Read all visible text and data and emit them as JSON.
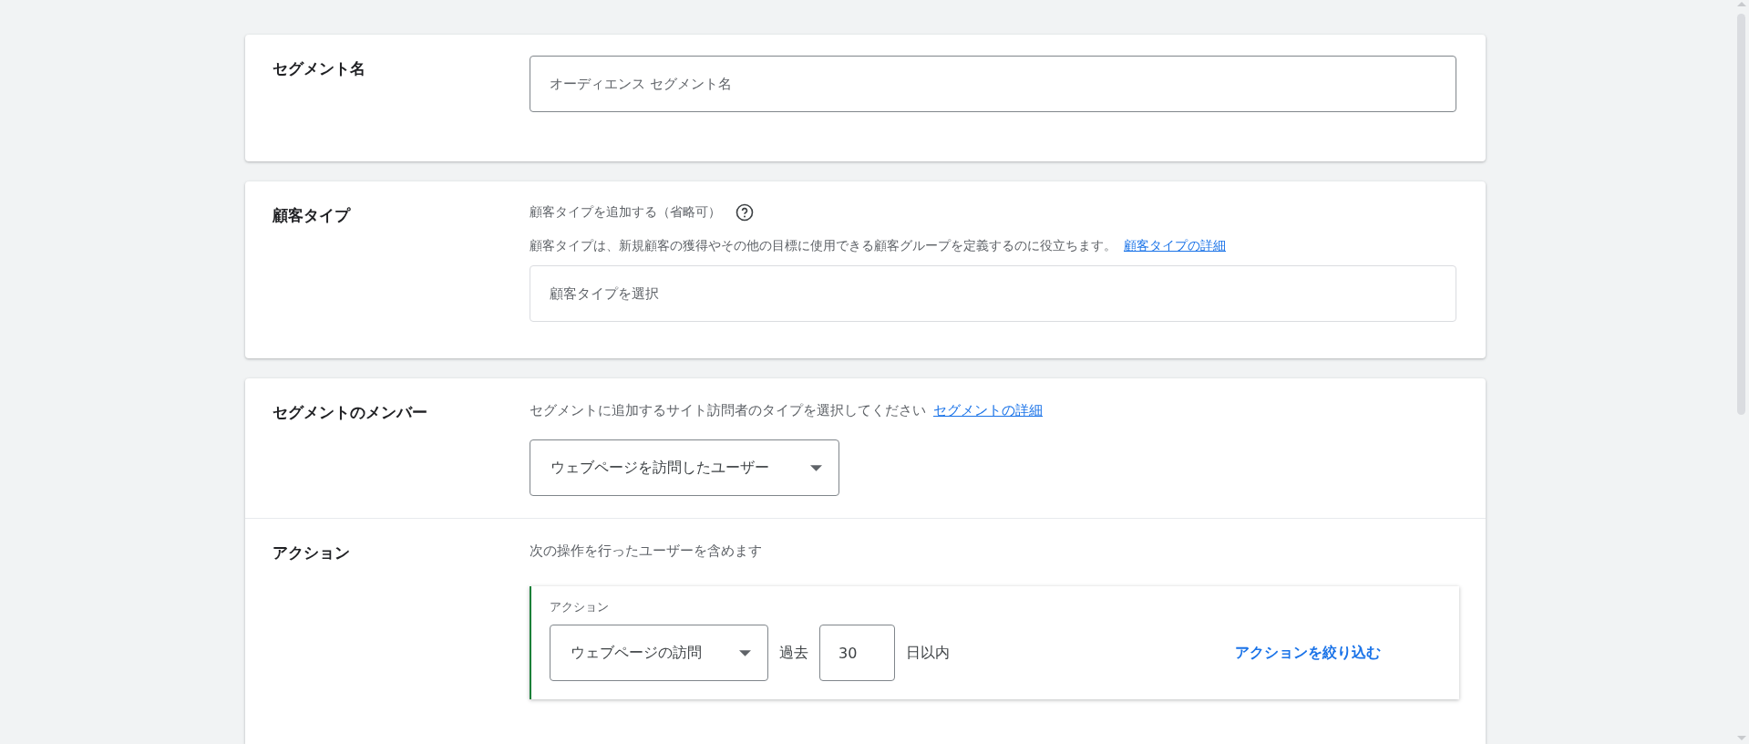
{
  "sections": [
    {
      "kind": "name",
      "title": "セグメント名",
      "placeholder": "オーディエンス セグメント名"
    },
    {
      "kind": "customer_type",
      "title": "顧客タイプ",
      "label": "顧客タイプを追加する（省略可）",
      "description": "顧客タイプは、新規顧客の獲得やその他の目標に使用できる顧客グループを定義するのに役立ちます。",
      "link": "顧客タイプの詳細",
      "placeholder": "顧客タイプを選択"
    },
    {
      "kind": "members",
      "title": "セグメントのメンバー",
      "description": "セグメントに追加するサイト訪問者のタイプを選択してください",
      "link": "セグメントの詳細",
      "dropdown": "ウェブページを訪問したユーザー"
    },
    {
      "kind": "action",
      "title": "アクション",
      "description": "次の操作を行ったユーザーを含めます",
      "action": {
        "label": "アクション",
        "dropdown": "ウェブページの訪問",
        "prefix": "過去",
        "days": "30",
        "suffix": "日以内",
        "refine": "アクションを絞り込む"
      }
    }
  ]
}
